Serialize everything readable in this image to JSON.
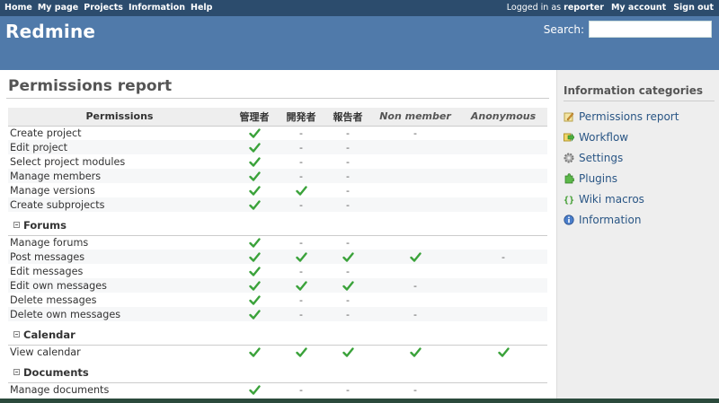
{
  "top_menu": {
    "items": [
      "Home",
      "My page",
      "Projects",
      "Information",
      "Help"
    ],
    "logged_prefix": "Logged in as",
    "user": "reporter",
    "my_account": "My account",
    "sign_out": "Sign out"
  },
  "header": {
    "title": "Redmine",
    "search_label": "Search:",
    "search_value": ""
  },
  "content": {
    "title": "Permissions report",
    "columns": {
      "permissions": "Permissions",
      "role1": "管理者",
      "role2": "開発者",
      "role3": "報告者",
      "non_member": "Non member",
      "anonymous": "Anonymous"
    },
    "rows": [
      {
        "type": "perm",
        "name": "Create project",
        "v": [
          "y",
          "-",
          "-",
          "-",
          ""
        ]
      },
      {
        "type": "perm",
        "name": "Edit project",
        "v": [
          "y",
          "-",
          "-",
          "",
          ""
        ]
      },
      {
        "type": "perm",
        "name": "Select project modules",
        "v": [
          "y",
          "-",
          "-",
          "",
          ""
        ]
      },
      {
        "type": "perm",
        "name": "Manage members",
        "v": [
          "y",
          "-",
          "-",
          "",
          ""
        ]
      },
      {
        "type": "perm",
        "name": "Manage versions",
        "v": [
          "y",
          "y",
          "-",
          "",
          ""
        ]
      },
      {
        "type": "perm",
        "name": "Create subprojects",
        "v": [
          "y",
          "-",
          "-",
          "",
          ""
        ]
      },
      {
        "type": "group",
        "name": "Forums"
      },
      {
        "type": "perm",
        "name": "Manage forums",
        "v": [
          "y",
          "-",
          "-",
          "",
          ""
        ]
      },
      {
        "type": "perm",
        "name": "Post messages",
        "v": [
          "y",
          "y",
          "y",
          "y",
          "-"
        ]
      },
      {
        "type": "perm",
        "name": "Edit messages",
        "v": [
          "y",
          "-",
          "-",
          "",
          ""
        ]
      },
      {
        "type": "perm",
        "name": "Edit own messages",
        "v": [
          "y",
          "y",
          "y",
          "-",
          ""
        ]
      },
      {
        "type": "perm",
        "name": "Delete messages",
        "v": [
          "y",
          "-",
          "-",
          "",
          ""
        ]
      },
      {
        "type": "perm",
        "name": "Delete own messages",
        "v": [
          "y",
          "-",
          "-",
          "-",
          ""
        ]
      },
      {
        "type": "group",
        "name": "Calendar"
      },
      {
        "type": "perm",
        "name": "View calendar",
        "v": [
          "y",
          "y",
          "y",
          "y",
          "y"
        ]
      },
      {
        "type": "group",
        "name": "Documents"
      },
      {
        "type": "perm",
        "name": "Manage documents",
        "v": [
          "y",
          "-",
          "-",
          "-",
          ""
        ]
      }
    ]
  },
  "sidebar": {
    "title": "Information categories",
    "items": [
      {
        "label": "Permissions report",
        "icon": "permissions-icon"
      },
      {
        "label": "Workflow",
        "icon": "workflow-icon"
      },
      {
        "label": "Settings",
        "icon": "settings-icon"
      },
      {
        "label": "Plugins",
        "icon": "plugins-icon"
      },
      {
        "label": "Wiki macros",
        "icon": "wiki-macros-icon"
      },
      {
        "label": "Information",
        "icon": "information-icon"
      }
    ]
  },
  "colors": {
    "top_menu": "#2c4c6d",
    "header": "#507aaa",
    "link": "#2a5685",
    "check": "#3aa23a"
  }
}
